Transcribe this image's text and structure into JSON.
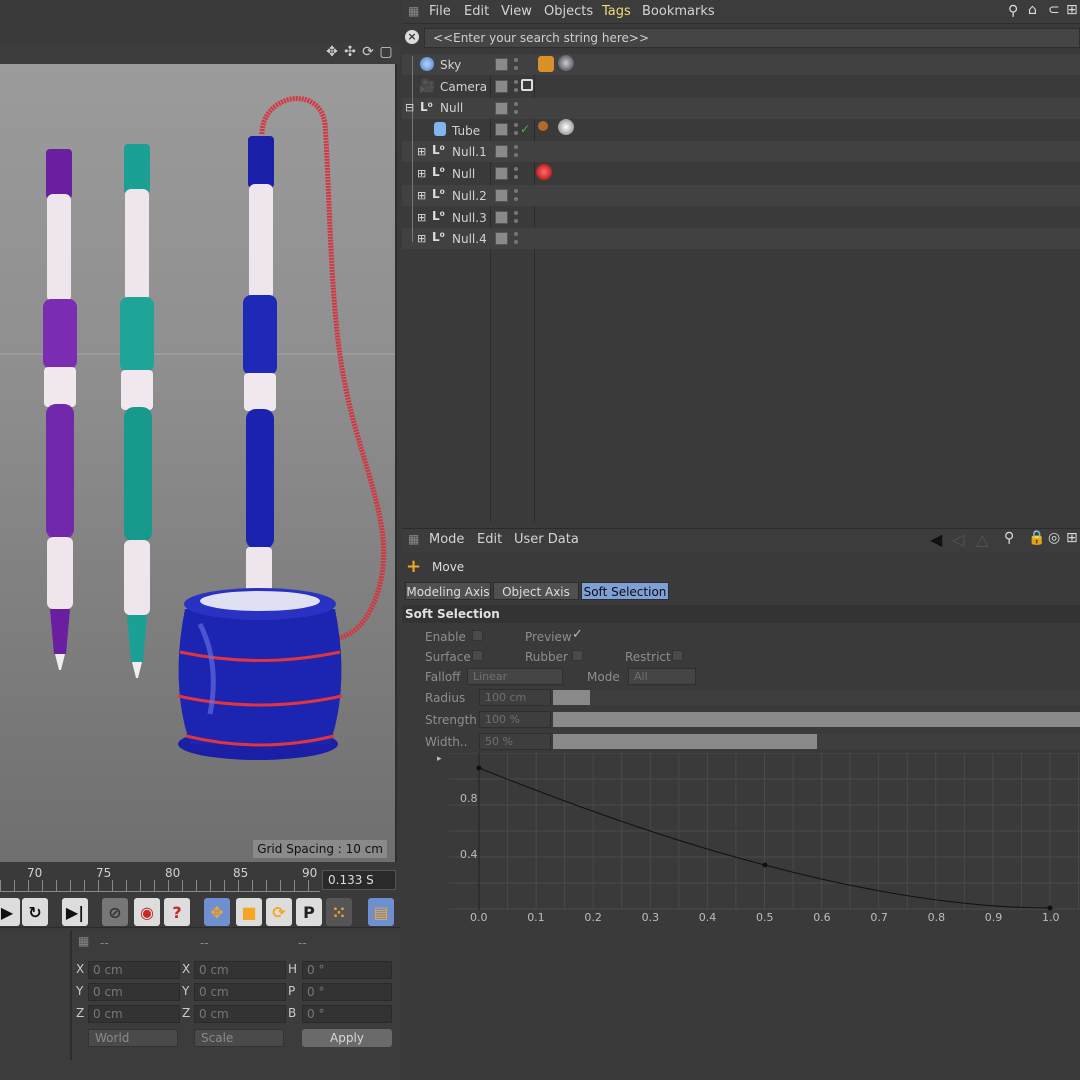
{
  "viewport": {
    "grid_spacing": "Grid Spacing : 10 cm"
  },
  "timeline": {
    "ticks": [
      "70",
      "75",
      "80",
      "85",
      "90"
    ],
    "time": "0.133 S"
  },
  "coordinates": {
    "headers": [
      "--",
      "--",
      "--"
    ],
    "rows": [
      {
        "l1": "X",
        "v1": "0 cm",
        "l2": "X",
        "v2": "0 cm",
        "l3": "H",
        "v3": "0 °"
      },
      {
        "l1": "Y",
        "v1": "0 cm",
        "l2": "Y",
        "v2": "0 cm",
        "l3": "P",
        "v3": "0 °"
      },
      {
        "l1": "Z",
        "v1": "0 cm",
        "l2": "Z",
        "v2": "0 cm",
        "l3": "B",
        "v3": "0 °"
      }
    ],
    "world": "World",
    "scale": "Scale",
    "apply": "Apply"
  },
  "object_manager": {
    "menu": [
      "File",
      "Edit",
      "View",
      "Objects",
      "Tags",
      "Bookmarks"
    ],
    "active_menu": "Tags",
    "search_placeholder": "<<Enter your search string here>>",
    "objects": [
      {
        "name": "Sky",
        "icon": "sky-icon"
      },
      {
        "name": "Camera",
        "icon": "camera-icon"
      },
      {
        "name": "Null",
        "icon": "null-icon"
      },
      {
        "name": "Tube",
        "icon": "tube-icon"
      },
      {
        "name": "Null.1",
        "icon": "null-icon"
      },
      {
        "name": "Null",
        "icon": "null-icon"
      },
      {
        "name": "Null.2",
        "icon": "null-icon"
      },
      {
        "name": "Null.3",
        "icon": "null-icon"
      },
      {
        "name": "Null.4",
        "icon": "null-icon"
      }
    ]
  },
  "attribute_manager": {
    "menu": [
      "Mode",
      "Edit",
      "User Data"
    ],
    "tool": "Move",
    "tabs": [
      "Modeling Axis",
      "Object Axis",
      "Soft Selection"
    ],
    "active_tab": "Soft Selection",
    "section": "Soft Selection",
    "labels": {
      "enable": "Enable",
      "preview": "Preview",
      "surface": "Surface",
      "rubber": "Rubber",
      "restrict": "Restrict",
      "falloff": "Falloff",
      "mode": "Mode",
      "radius": "Radius",
      "strength": "Strength",
      "width": "Width.."
    },
    "values": {
      "falloff": "Linear",
      "mode": "All",
      "radius": "100 cm",
      "strength": "100 %",
      "width": "50 %"
    },
    "levels": {
      "radius": 0.07,
      "strength": 1.0,
      "width": 0.5
    },
    "curve": {
      "y_ticks": [
        "0.8",
        "0.4"
      ],
      "x_ticks": [
        "0.0",
        "0.1",
        "0.2",
        "0.3",
        "0.4",
        "0.5",
        "0.6",
        "0.7",
        "0.8",
        "0.9",
        "1.0"
      ]
    }
  }
}
